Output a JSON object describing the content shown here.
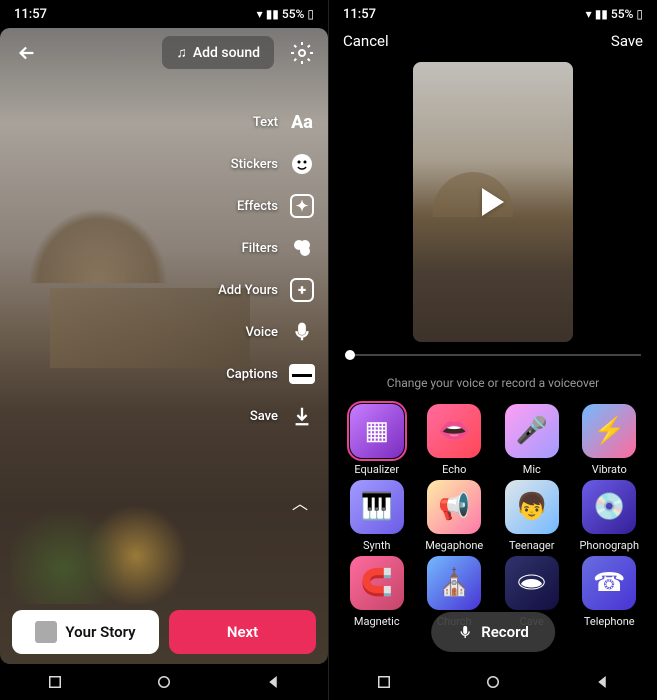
{
  "status": {
    "time": "11:57",
    "battery": "55%"
  },
  "left": {
    "addSound": "Add sound",
    "tools": [
      {
        "label": "Text",
        "icon": "Aa"
      },
      {
        "label": "Stickers",
        "icon": "sticker"
      },
      {
        "label": "Effects",
        "icon": "star"
      },
      {
        "label": "Filters",
        "icon": "circles"
      },
      {
        "label": "Add Yours",
        "icon": "plus"
      },
      {
        "label": "Voice",
        "icon": "mic"
      },
      {
        "label": "Captions",
        "icon": "cc"
      },
      {
        "label": "Save",
        "icon": "download"
      }
    ],
    "story": "Your Story",
    "next": "Next"
  },
  "right": {
    "cancel": "Cancel",
    "save": "Save",
    "hint": "Change your voice or record a voiceover",
    "record": "Record",
    "effects": [
      {
        "name": "Equalizer",
        "cls": "ic-eq",
        "emoji": "▦",
        "selected": true
      },
      {
        "name": "Echo",
        "cls": "ic-ec",
        "emoji": "👄"
      },
      {
        "name": "Mic",
        "cls": "ic-mi",
        "emoji": "🎤"
      },
      {
        "name": "Vibrato",
        "cls": "ic-vi",
        "emoji": "⚡"
      },
      {
        "name": "Synth",
        "cls": "ic-sy",
        "emoji": "🎹"
      },
      {
        "name": "Megaphone",
        "cls": "ic-me",
        "emoji": "📢"
      },
      {
        "name": "Teenager",
        "cls": "ic-te",
        "emoji": "👦"
      },
      {
        "name": "Phonograph",
        "cls": "ic-ph",
        "emoji": "💿"
      },
      {
        "name": "Magnetic",
        "cls": "ic-ma",
        "emoji": "🧲"
      },
      {
        "name": "Church",
        "cls": "ic-ch",
        "emoji": "⛪"
      },
      {
        "name": "Cave",
        "cls": "ic-ca",
        "emoji": "🕳"
      },
      {
        "name": "Telephone",
        "cls": "ic-tp",
        "emoji": "☎"
      }
    ]
  }
}
